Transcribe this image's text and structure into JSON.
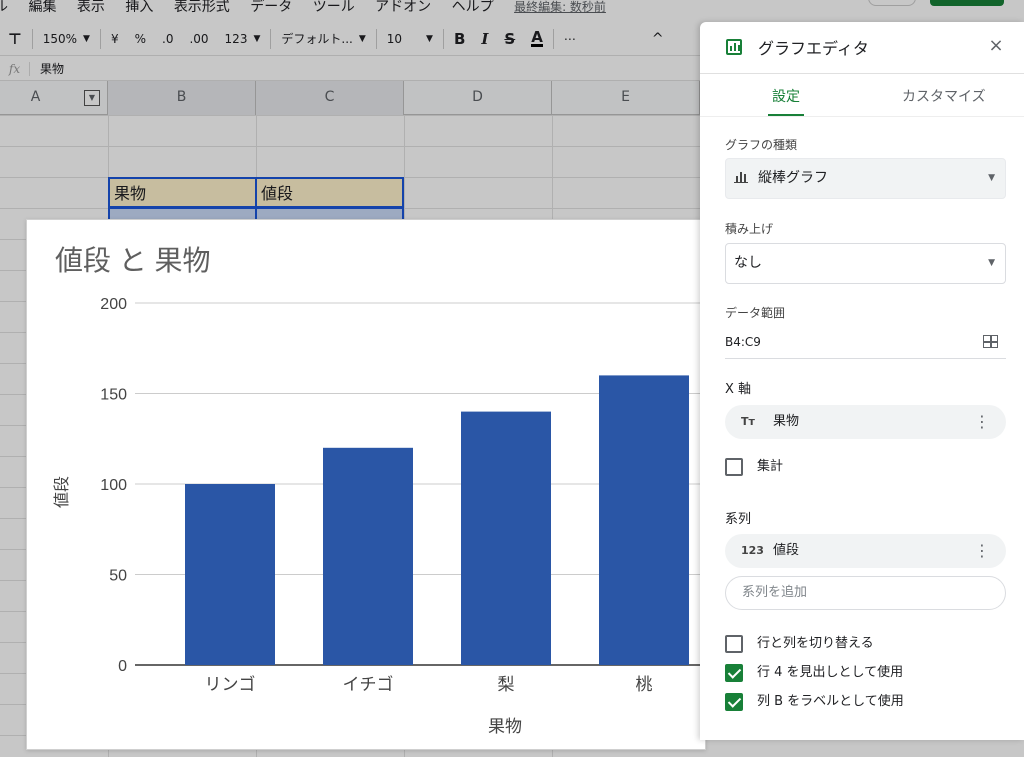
{
  "menubar": {
    "items": [
      "ル",
      "編集",
      "表示",
      "挿入",
      "表示形式",
      "データ",
      "ツール",
      "アドオン",
      "ヘルプ"
    ],
    "last_edit": "最終編集: 数秒前"
  },
  "toolbar": {
    "zoom": "150%",
    "currency": "¥",
    "percent": "%",
    "decrease_decimal": ".0",
    "increase_decimal": ".00",
    "number_format": "123",
    "font": "デフォルト...",
    "font_size": "10",
    "bold": "B",
    "italic": "I",
    "strike": "S",
    "text_color": "A",
    "more": "⋯",
    "collapse": "^"
  },
  "formula_bar": {
    "fx": "fx",
    "value": "果物"
  },
  "columns": [
    "A",
    "B",
    "C",
    "D",
    "E"
  ],
  "sheet": {
    "header_cells": [
      "果物",
      "値段"
    ]
  },
  "chart": {
    "title": "値段 と 果物",
    "xlabel": "果物",
    "ylabel": "値段",
    "bar_color": "#2a56a6"
  },
  "chart_data": {
    "type": "bar",
    "title": "値段 と 果物",
    "xlabel": "果物",
    "ylabel": "値段",
    "categories": [
      "リンゴ",
      "イチゴ",
      "梨",
      "桃"
    ],
    "values": [
      100,
      120,
      140,
      160
    ],
    "ylim": [
      0,
      200
    ],
    "yticks": [
      0,
      50,
      100,
      150,
      200
    ],
    "grid": true,
    "legend": "none"
  },
  "editor": {
    "title": "グラフエディタ",
    "close": "×",
    "tabs": {
      "setup": "設定",
      "customize": "カスタマイズ"
    },
    "chart_type_label": "グラフの種類",
    "chart_type_value": "縦棒グラフ",
    "stacking_label": "積み上げ",
    "stacking_value": "なし",
    "data_range_label": "データ範囲",
    "data_range_value": "B4:C9",
    "x_axis_label": "X 軸",
    "x_axis_chip_icon": "Tт",
    "x_axis_chip": "果物",
    "aggregate_label": "集計",
    "series_label": "系列",
    "series_chip_icon": "123",
    "series_chip": "値段",
    "add_series_placeholder": "系列を追加",
    "switch_rows_cols": "行と列を切り替える",
    "use_row_header": "行 4 を見出しとして使用",
    "use_col_labels": "列 B をラベルとして使用",
    "accent_color": "#188038"
  }
}
